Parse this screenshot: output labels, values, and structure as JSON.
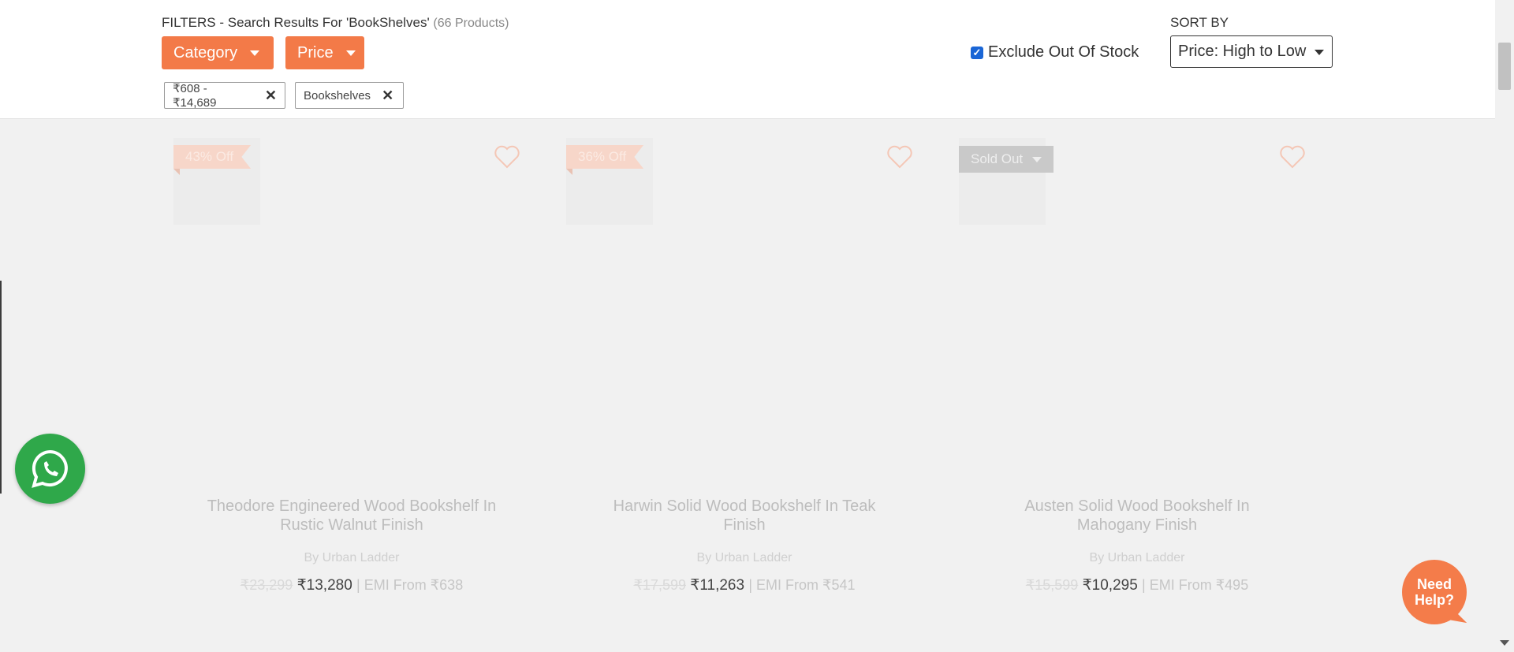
{
  "header": {
    "filters_prefix": "FILTERS - Search Results For 'BookShelves'",
    "product_count": "(66 Products)",
    "category_button": "Category",
    "price_button": "Price",
    "chips": [
      {
        "label": "₹608 - ₹14,689"
      },
      {
        "label": "Bookshelves"
      }
    ],
    "exclude_out_of_stock": {
      "label": "Exclude Out Of Stock",
      "checked": true
    },
    "sort_by_label": "SORT BY",
    "sort_selected": "Price: High to Low"
  },
  "products": [
    {
      "badge": "43% Off",
      "name_line1": "Theodore Engineered Wood Bookshelf In",
      "name_line2": "Rustic Walnut Finish",
      "brand": "By Urban Ladder",
      "old_price": "₹23,299",
      "price": "₹13,280",
      "emi": "| EMI From ₹638"
    },
    {
      "badge": "36% Off",
      "name_line1": "Harwin Solid Wood Bookshelf In Teak",
      "name_line2": "Finish",
      "brand": "By Urban Ladder",
      "old_price": "₹17,599",
      "price": "₹11,263",
      "emi": "| EMI From ₹541"
    },
    {
      "badge": "Sold Out",
      "name_line1": "Austen Solid Wood Bookshelf In",
      "name_line2": "Mahogany Finish",
      "brand": "By Urban Ladder",
      "old_price": "₹15,599",
      "price": "₹10,295",
      "emi": "| EMI From ₹495"
    }
  ],
  "widgets": {
    "help_line1": "Need",
    "help_line2": "Help?"
  },
  "colors": {
    "accent": "#f37a48",
    "whatsapp": "#2fa84a",
    "page_bg": "#f1f1f1"
  }
}
